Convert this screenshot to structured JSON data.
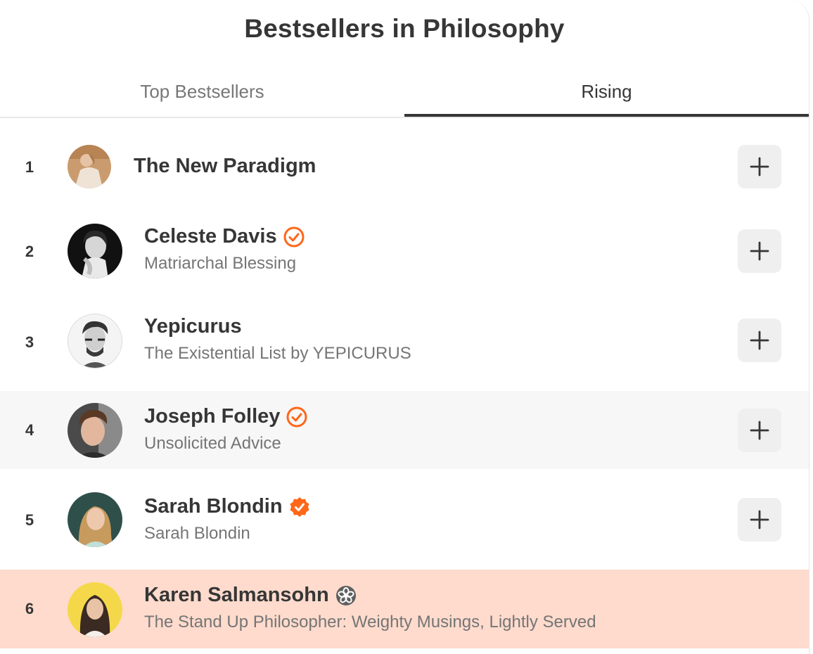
{
  "header": {
    "title": "Bestsellers in Philosophy"
  },
  "tabs": [
    {
      "label": "Top Bestsellers",
      "active": false
    },
    {
      "label": "Rising",
      "active": true
    }
  ],
  "colors": {
    "accent": "#ff6719",
    "row_hover": "#f7f7f7",
    "row_highlight": "#fedbcd",
    "button_bg": "#efefef",
    "text_primary": "#363636",
    "text_secondary": "#757575"
  },
  "list": [
    {
      "rank": "1",
      "name": "The New Paradigm",
      "subtitle": "",
      "badge": "none"
    },
    {
      "rank": "2",
      "name": "Celeste Davis",
      "subtitle": "Matriarchal Blessing",
      "badge": "check-circle-outline-icon"
    },
    {
      "rank": "3",
      "name": "Yepicurus",
      "subtitle": "The Existential List by YEPICURUS",
      "badge": "none"
    },
    {
      "rank": "4",
      "name": "Joseph Folley",
      "subtitle": "Unsolicited Advice",
      "badge": "check-circle-outline-icon"
    },
    {
      "rank": "5",
      "name": "Sarah Blondin",
      "subtitle": "Sarah Blondin",
      "badge": "check-badge-filled-icon"
    },
    {
      "rank": "6",
      "name": "Karen Salmansohn",
      "subtitle": "The Stand Up Philosopher: Weighty Musings, Lightly Served",
      "badge": "flower-badge-icon"
    }
  ],
  "buttons": {
    "add_icon": "plus-icon"
  }
}
